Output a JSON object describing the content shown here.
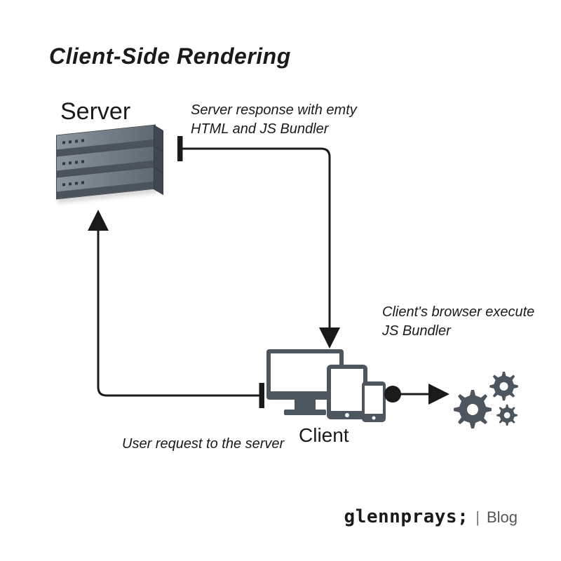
{
  "title": "Client-Side Rendering",
  "nodes": {
    "server": {
      "label": "Server"
    },
    "client": {
      "label": "Client"
    }
  },
  "edges": {
    "server_response": "Server response with emty HTML and JS Bundler",
    "execute_bundler": "Client's browser execute JS Bundler",
    "user_request": "User request to the server"
  },
  "brand": {
    "main": "glennprays;",
    "sep": "|",
    "sub": "Blog"
  }
}
